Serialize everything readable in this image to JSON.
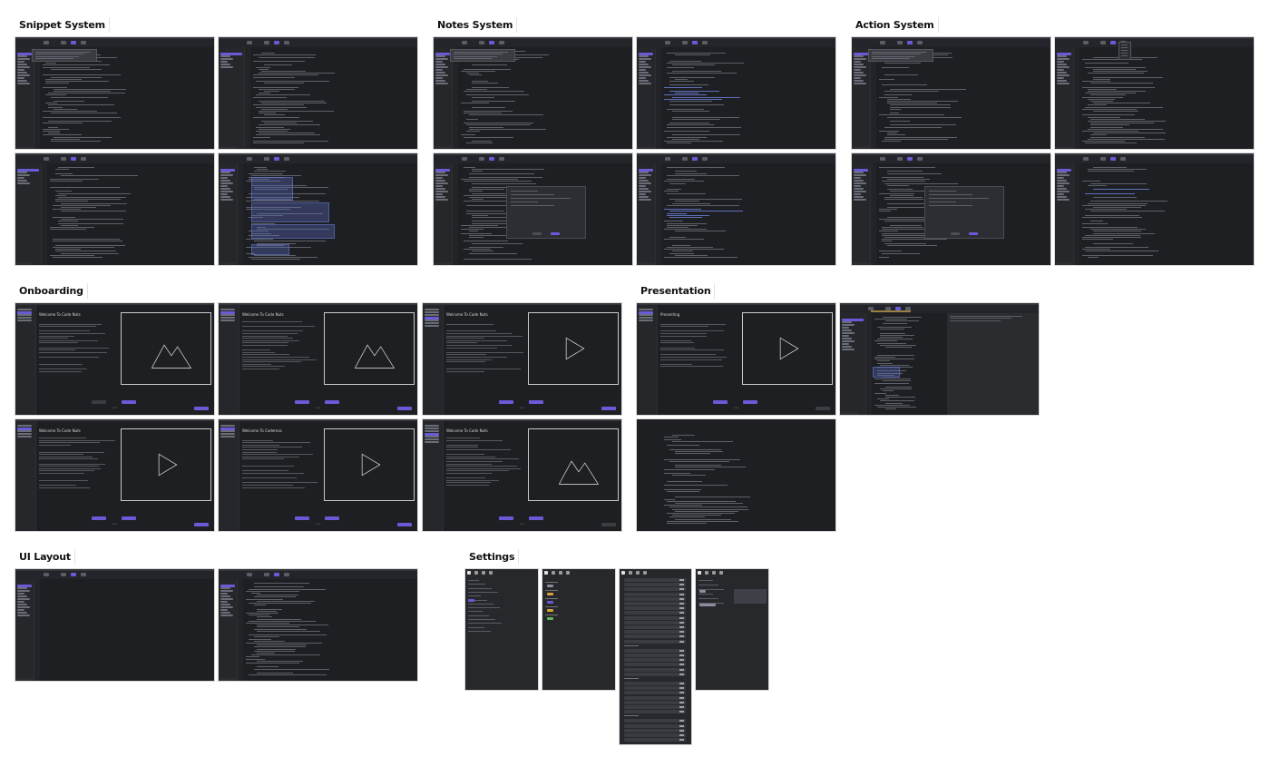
{
  "sections": {
    "snippet": "Snippet System",
    "notes": "Notes System",
    "action": "Action System",
    "onboarding": "Onboarding",
    "presentation": "Presentation",
    "ui_layout": "UI Layout",
    "settings": "Settings"
  },
  "onboarding": {
    "title_code_nuts": "Welcome To Code Nuts",
    "title_codemos": "Welcome To Codemos",
    "presenting": "Presenting",
    "page_indicator": "• • •"
  },
  "colors": {
    "accent": "#6b5ad8",
    "frame_bg": "#1e1f22",
    "code": "#8f95a3"
  }
}
